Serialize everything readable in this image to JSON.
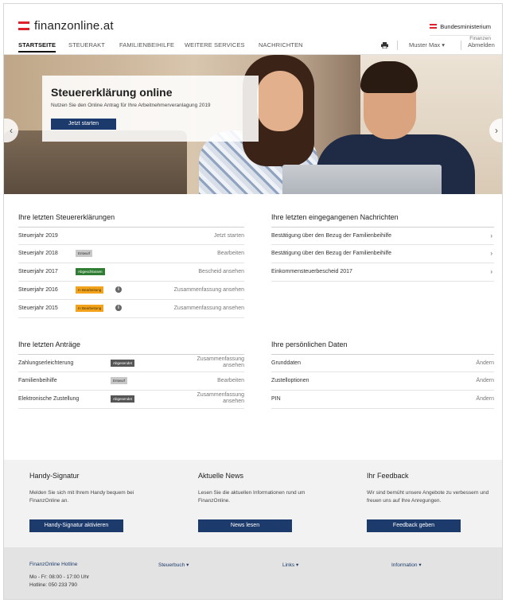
{
  "header": {
    "logo_text": "finanzonline.at",
    "ministry_line1": "Bundesministerium",
    "ministry_line2": "Finanzen"
  },
  "nav": {
    "items": [
      "STARTSEITE",
      "STEUERAKT",
      "FAMILIENBEIHILFE",
      "WEITERE SERVICES",
      "NACHRICHTEN"
    ],
    "user_label": "Muster Max",
    "logout_label": "Abmelden"
  },
  "hero": {
    "title": "Steuererklärung online",
    "subtitle": "Nutzen Sie den Online Antrag für Ihre Arbeitnehmerveranlagung 2019",
    "button_label": "Jetzt starten"
  },
  "tax_returns": {
    "title": "Ihre letzten Steuererklärungen",
    "rows": [
      {
        "label": "Steuerjahr 2019",
        "badge": "",
        "action": "Jetzt starten"
      },
      {
        "label": "Steuerjahr 2018",
        "badge": "Entwurf",
        "action": "Bearbeiten"
      },
      {
        "label": "Steuerjahr 2017",
        "badge": "Abgeschlossen",
        "action": "Bescheid ansehen"
      },
      {
        "label": "Steuerjahr 2016",
        "badge": "In Bearbeitung",
        "action": "Zusammenfassung ansehen"
      },
      {
        "label": "Steuerjahr 2015",
        "badge": "In Bearbeitung",
        "action": "Zusammenfassung ansehen"
      }
    ]
  },
  "messages": {
    "title": "Ihre letzten eingegangenen Nachrichten",
    "rows": [
      {
        "label": "Bestätigung über den Bezug der Familienbeihilfe"
      },
      {
        "label": "Bestätigung über den Bezug der Familienbeihilfe"
      },
      {
        "label": "Einkommensteuerbescheid 2017"
      }
    ]
  },
  "applications": {
    "title": "Ihre letzten Anträge",
    "rows": [
      {
        "label": "Zahlungserleichterung",
        "badge": "Abgesendet",
        "action_line1": "Zusammenfassung",
        "action_line2": "ansehen"
      },
      {
        "label": "Familienbeihilfe",
        "badge": "Entwurf",
        "action_line1": "Bearbeiten",
        "action_line2": ""
      },
      {
        "label": "Elektronische Zustellung",
        "badge": "Abgesendet",
        "action_line1": "Zusammenfassung",
        "action_line2": "ansehen"
      }
    ]
  },
  "personal_data": {
    "title": "Ihre persönlichen Daten",
    "rows": [
      {
        "label": "Grunddaten",
        "action": "Ändern"
      },
      {
        "label": "Zustelloptionen",
        "action": "Ändern"
      },
      {
        "label": "PIN",
        "action": "Ändern"
      }
    ]
  },
  "teasers": [
    {
      "title": "Handy-Signatur",
      "text": "Melden Sie sich mit Ihrem Handy bequem bei FinanzOnline an.",
      "button": "Handy-Signatur aktivieren"
    },
    {
      "title": "Aktuelle News",
      "text": "Lesen Sie die aktuellen Informationen rund um FinanzOnline.",
      "button": "News lesen"
    },
    {
      "title": "Ihr Feedback",
      "text": "Wir sind bemüht unsere Angebote zu verbessern und freuen uns auf Ihre Anregungen.",
      "button": "Feedback geben"
    }
  ],
  "footer": {
    "hotline_title": "FinanzOnline Hotline",
    "hotline_hours": "Mo - Fr: 08:00 - 17:00 Uhr",
    "hotline_phone": "Hotline: 050 233 790",
    "links": [
      "Steuerbuch",
      "Links",
      "Information"
    ]
  },
  "colors": {
    "primary_button": "#1c3a6b",
    "flag_red": "#e0202b",
    "badge_completed": "#2e7d32",
    "badge_in_progress": "#f2a31b"
  }
}
